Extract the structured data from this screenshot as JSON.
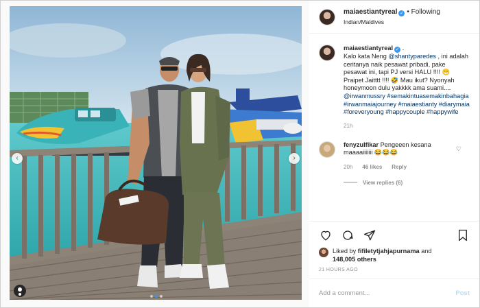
{
  "post": {
    "image_alt": "Couple posing on wooden jetty in front of seaplane",
    "carousel_total": 3,
    "carousel_active": 1
  },
  "header": {
    "username": "maiaestiantyreal",
    "verified_mark": "✓",
    "follow_status": "• Following",
    "location": "Indian/Maldives"
  },
  "caption": {
    "username": "maiaestiantyreal",
    "verified_mark": "✓",
    "after_name": " .",
    "text_1": "Kalo kata Neng ",
    "mention_1": "@shantyparedes",
    "text_2": " , ini adalah ceritanya naik pesawat pribadi, pake pesawat ini, tapi PJ versi HALU !!!! 😁 Praipet Jaitttt !!!! 🤣 Mau ikut? Nyonyah honeymoon dulu yakkkk ama suami.... ",
    "mention_2": "@irwanmussry",
    "hashtags": "#semakintuasemakinbahagia #irwanmaiajourney #maiaestianty #diarymaia #foreveryoung #happycouple #happywife",
    "age": "21h"
  },
  "comment": {
    "username": "fenyzulfikar",
    "text": "Pengeeen kesana maaaaiiiiiii 😂😂😂",
    "age": "20h",
    "likes": "46 likes",
    "reply": "Reply",
    "view_replies": "View replies (6)"
  },
  "actions": {
    "liked_by_prefix": "Liked by ",
    "liked_by_user": "fifiletytjahjapurnama",
    "and": " and",
    "others_count": "148,005 others",
    "timestamp": "21 HOURS AGO"
  },
  "add_comment": {
    "placeholder": "Add a comment...",
    "post_label": "Post"
  },
  "icons": [
    "heart-icon",
    "comment-icon",
    "share-icon",
    "bookmark-icon",
    "tag-user-icon",
    "chevron-left-icon",
    "chevron-right-icon"
  ],
  "colors": {
    "link": "#003569",
    "accent": "#3897f0",
    "post_disabled": "#b2dffc",
    "muted": "#8e8e8e"
  }
}
